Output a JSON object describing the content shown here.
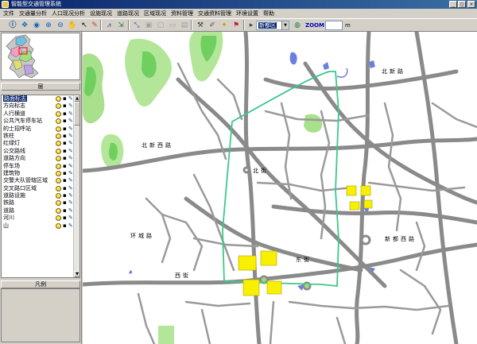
{
  "window": {
    "title": "智能型交通管理系统"
  },
  "menu": [
    "文件",
    "交通量分析",
    "人口现况分析",
    "设施现况",
    "道路现况",
    "区域现况",
    "资料管理",
    "交通资料管理",
    "环境设置",
    "帮助"
  ],
  "toolbar": {
    "region_value": "新都区",
    "zoom_label": "ZOOM",
    "zoom_value": "",
    "zoom_unit": "m"
  },
  "panel": {
    "layers_header": "层",
    "legend_header": "凡例",
    "layers": [
      "路面标志",
      "方向标志",
      "人行横道",
      "公共汽车停车站",
      "的士招呼站",
      "铁柱",
      "红绿灯",
      "公交路线",
      "道路方向",
      "停车场",
      "建筑物",
      "交警大队管辖区域",
      "交叉路口区域",
      "道路设施",
      "铁路",
      "道路",
      "河川",
      "山"
    ],
    "selected_layer": "路面标志"
  },
  "map": {
    "labels": [
      "北新西路",
      "北新路",
      "新都西路",
      "东街",
      "北街",
      "西街",
      "环城路"
    ]
  },
  "colors": {
    "title_bar": "#0a246a",
    "selection": "#0a246a",
    "road": "#7f7f7f",
    "water": "#6b7fe0",
    "vegetation": "#6fd060",
    "boundary": "#3cc88c",
    "building": "#f8f000"
  }
}
